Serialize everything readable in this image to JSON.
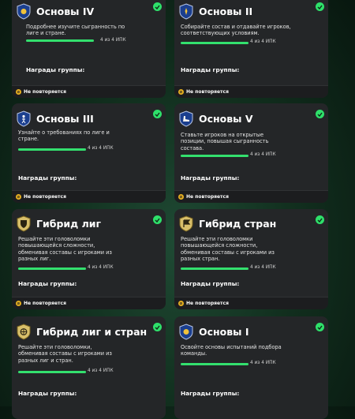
{
  "accent_color": "#2ee06a",
  "cards": [
    {
      "title": "Основы IV",
      "description": "Подробнее изучите сыгранность по лиге и стране.",
      "progress_text": "4 из 4 ИПК",
      "progress": 1.0,
      "rewards_label": "Награды группы:",
      "repeat_label": "Не повторяется",
      "icon": "shield-ball-badge-icon"
    },
    {
      "title": "Основы II",
      "description": "Собирайте состав и отдавайте игроков, соответствующих условиям.",
      "progress_text": "4 из 4 ИПК",
      "progress": 1.0,
      "rewards_label": "Награды группы:",
      "repeat_label": "Не повторяется",
      "icon": "shield-badge-icon"
    },
    {
      "title": "Основы III",
      "description": "Узнайте о требованиях по лиге и стране.",
      "progress_text": "4 из 4 ИПК",
      "progress": 1.0,
      "rewards_label": "Награды группы:",
      "repeat_label": "Не повторяется",
      "icon": "shield-player-badge-icon"
    },
    {
      "title": "Основы V",
      "description": "Ставьте игроков на открытые позиции, повышая сыгранность состава.",
      "progress_text": "4 из 4 ИПК",
      "progress": 1.0,
      "rewards_label": "Награды группы:",
      "repeat_label": "Не повторяется",
      "icon": "shield-boot-badge-icon"
    },
    {
      "title": "Гибрид лиг",
      "description": "Решайте эти головоломки повышающейся сложности, обменивая составы с игроками из разных лиг.",
      "progress_text": "4 из 4 ИПК",
      "progress": 1.0,
      "rewards_label": "Награды группы:",
      "repeat_label": "Не повторяется",
      "icon": "gold-shield-badge-icon"
    },
    {
      "title": "Гибрид стран",
      "description": "Решайте эти головоломки повышающейся сложности, обменивая составы с игроками из разных стран.",
      "progress_text": "4 из 4 ИПК",
      "progress": 1.0,
      "rewards_label": "Награды группы:",
      "repeat_label": "Не повторяется",
      "icon": "gold-shield-flag-badge-icon"
    },
    {
      "title": "Гибрид лиг и стран",
      "description": "Решайте эти головоломки, обменивая составы с игроками из разных лиг и стран.",
      "progress_text": "4 из 4 ИПК",
      "progress": 1.0,
      "rewards_label": "Награды группы:",
      "repeat_label": "Не повторяется",
      "icon": "gold-shield-globe-badge-icon"
    },
    {
      "title": "Основы I",
      "description": "Освойте основы испытаний подбора команды.",
      "progress_text": "4 из 4 ИПК",
      "progress": 1.0,
      "rewards_label": "Награды группы:",
      "repeat_label": "",
      "icon": "shield-ball-badge-icon"
    }
  ]
}
